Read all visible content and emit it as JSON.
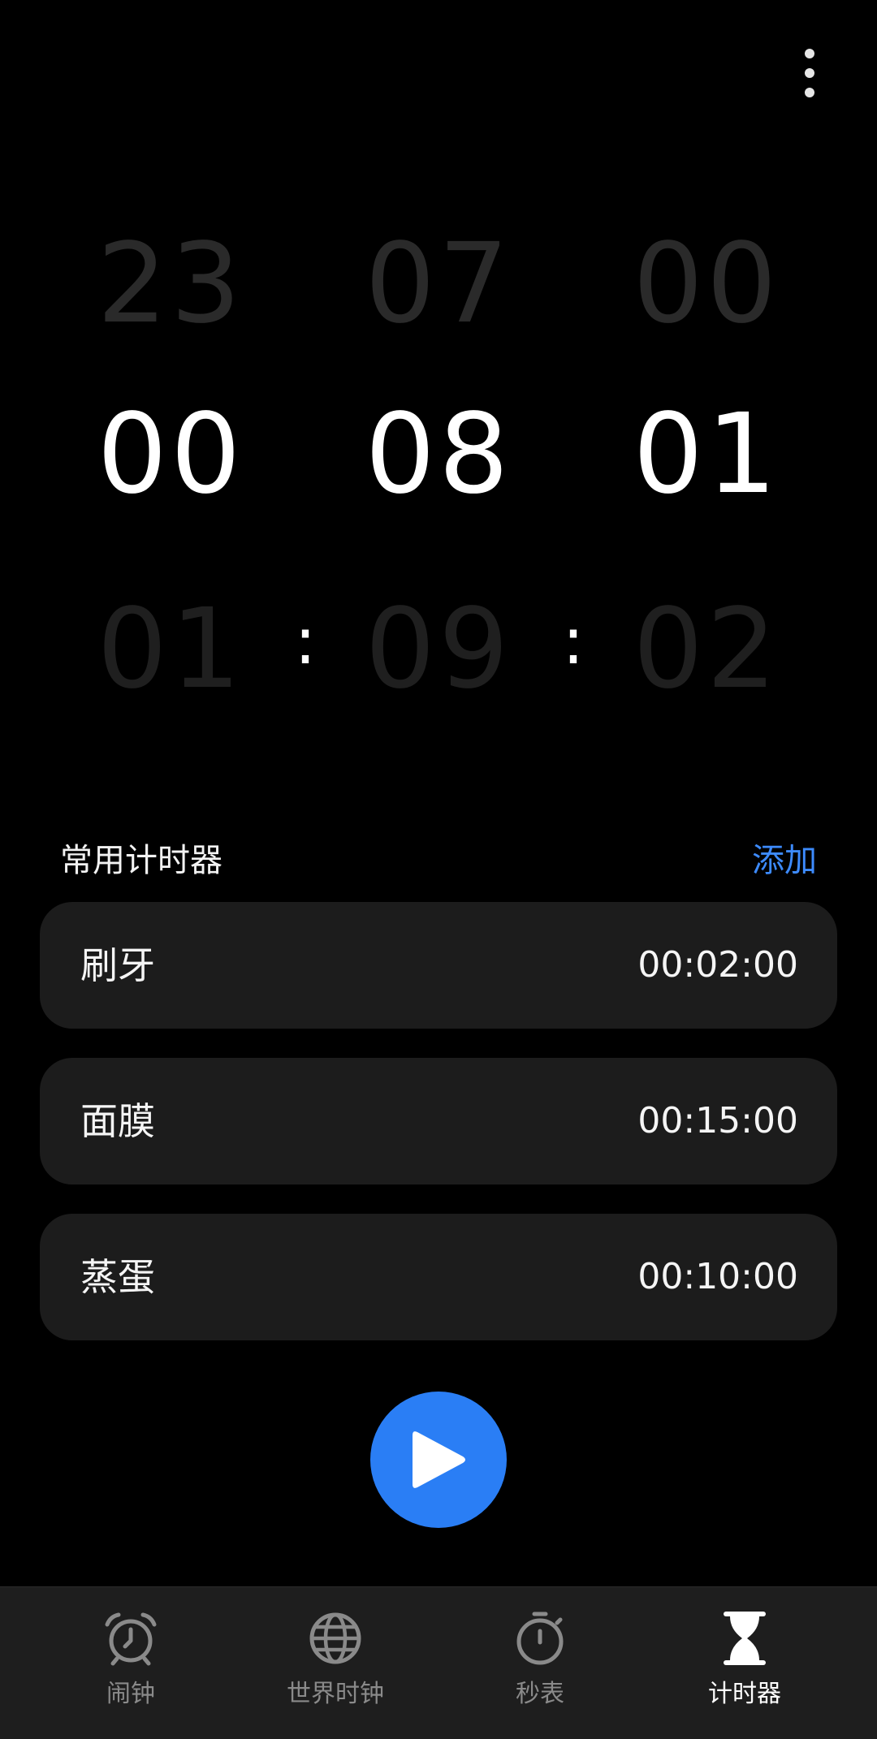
{
  "header": {
    "menu_icon": "more-vertical-icon"
  },
  "picker": {
    "hours": {
      "prev": "23",
      "current": "00",
      "next": "01"
    },
    "minutes": {
      "prev": "07",
      "current": "08",
      "next": "09"
    },
    "seconds": {
      "prev": "00",
      "current": "01",
      "next": "02"
    },
    "separator": ":"
  },
  "presets": {
    "title": "常用计时器",
    "add_label": "添加",
    "items": [
      {
        "name": "刷牙",
        "duration": "00:02:00"
      },
      {
        "name": "面膜",
        "duration": "00:15:00"
      },
      {
        "name": "蒸蛋",
        "duration": "00:10:00"
      }
    ]
  },
  "start_button": {
    "icon": "play-icon",
    "color": "#2a7ef5"
  },
  "colors": {
    "accent": "#3d8bff",
    "background": "#000000",
    "card": "#1c1c1c"
  },
  "tabs": [
    {
      "label": "闹钟",
      "icon": "alarm-clock-icon",
      "active": false
    },
    {
      "label": "世界时钟",
      "icon": "globe-icon",
      "active": false
    },
    {
      "label": "秒表",
      "icon": "stopwatch-icon",
      "active": false
    },
    {
      "label": "计时器",
      "icon": "hourglass-icon",
      "active": true
    }
  ]
}
